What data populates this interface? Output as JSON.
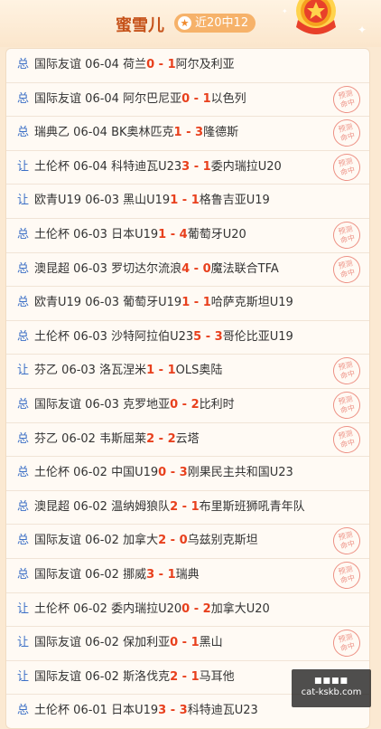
{
  "header": {
    "title": "蜜雪儿",
    "badge": "近20中12",
    "medal_icon": "star-medal-icon"
  },
  "stamp_text": [
    "预测",
    "命中"
  ],
  "colors": {
    "accent": "#c6531b",
    "score": "#e8401d",
    "type": "#3b6fc6",
    "stamp": "#e9786a"
  },
  "matches": [
    {
      "type": "总",
      "league": "国际友谊",
      "date": "06-04",
      "home": "荷兰",
      "score": "0 - 1",
      "away": "阿尔及利亚",
      "hit": false
    },
    {
      "type": "总",
      "league": "国际友谊",
      "date": "06-04",
      "home": "阿尔巴尼亚",
      "score": "0 - 1",
      "away": "以色列",
      "hit": true
    },
    {
      "type": "总",
      "league": "瑞典乙",
      "date": "06-04",
      "home": "BK奥林匹克",
      "score": "1 - 3",
      "away": "隆德斯",
      "hit": true
    },
    {
      "type": "让",
      "league": "土伦杯",
      "date": "06-04",
      "home": "科特迪瓦U23",
      "score": "3 - 1",
      "away": "委内瑞拉U20",
      "hit": true
    },
    {
      "type": "让",
      "league": "欧青U19",
      "date": "06-03",
      "home": "黑山U19",
      "score": "1 - 1",
      "away": "格鲁吉亚U19",
      "hit": false
    },
    {
      "type": "总",
      "league": "土伦杯",
      "date": "06-03",
      "home": "日本U19",
      "score": "1 - 4",
      "away": "葡萄牙U20",
      "hit": true
    },
    {
      "type": "总",
      "league": "澳昆超",
      "date": "06-03",
      "home": "罗切达尔流浪",
      "score": "4 - 0",
      "away": "魔法联合TFA",
      "hit": true
    },
    {
      "type": "总",
      "league": "欧青U19",
      "date": "06-03",
      "home": "葡萄牙U19",
      "score": "1 - 1",
      "away": "哈萨克斯坦U19",
      "hit": false
    },
    {
      "type": "总",
      "league": "土伦杯",
      "date": "06-03",
      "home": "沙特阿拉伯U23",
      "score": "5 - 3",
      "away": "哥伦比亚U19",
      "hit": false
    },
    {
      "type": "让",
      "league": "芬乙",
      "date": "06-03",
      "home": "洛瓦涅米",
      "score": "1 - 1",
      "away": "OLS奥陆",
      "hit": true
    },
    {
      "type": "总",
      "league": "国际友谊",
      "date": "06-03",
      "home": "克罗地亚",
      "score": "0 - 2",
      "away": "比利时",
      "hit": true
    },
    {
      "type": "总",
      "league": "芬乙",
      "date": "06-02",
      "home": "韦斯屈莱",
      "score": "2 - 2",
      "away": "云塔",
      "hit": true
    },
    {
      "type": "总",
      "league": "土伦杯",
      "date": "06-02",
      "home": "中国U19",
      "score": "0 - 3",
      "away": "刚果民主共和国U23",
      "hit": false
    },
    {
      "type": "总",
      "league": "澳昆超",
      "date": "06-02",
      "home": "温纳姆狼队",
      "score": "2 - 1",
      "away": "布里斯班狮吼青年队",
      "hit": false
    },
    {
      "type": "总",
      "league": "国际友谊",
      "date": "06-02",
      "home": "加拿大",
      "score": "2 - 0",
      "away": "乌兹别克斯坦",
      "hit": true
    },
    {
      "type": "总",
      "league": "国际友谊",
      "date": "06-02",
      "home": "挪威",
      "score": "3 - 1",
      "away": "瑞典",
      "hit": true
    },
    {
      "type": "让",
      "league": "土伦杯",
      "date": "06-02",
      "home": "委内瑞拉U20",
      "score": "0 - 2",
      "away": "加拿大U20",
      "hit": false
    },
    {
      "type": "让",
      "league": "国际友谊",
      "date": "06-02",
      "home": "保加利亚",
      "score": "0 - 1",
      "away": "黑山",
      "hit": true
    },
    {
      "type": "让",
      "league": "国际友谊",
      "date": "06-02",
      "home": "斯洛伐克",
      "score": "2 - 1",
      "away": "马耳他",
      "hit": false
    },
    {
      "type": "总",
      "league": "土伦杯",
      "date": "06-01",
      "home": "日本U19",
      "score": "3 - 3",
      "away": "科特迪瓦U23",
      "hit": false
    }
  ],
  "watermark": {
    "domain": "cat-kskb.com"
  }
}
